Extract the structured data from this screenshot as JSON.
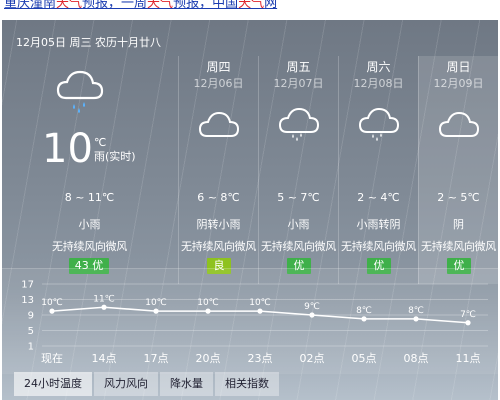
{
  "header": {
    "parts": [
      {
        "text": "重庆潼南",
        "accent": false
      },
      {
        "text": "天气",
        "accent": true
      },
      {
        "text": "预报，一周",
        "accent": false
      },
      {
        "text": "天气",
        "accent": true
      },
      {
        "text": "预报，中国",
        "accent": false
      },
      {
        "text": "天气",
        "accent": true
      },
      {
        "text": "网",
        "accent": false
      }
    ]
  },
  "today": {
    "date_line": "12月05日 周三 农历十月廿八",
    "temp": "10",
    "unit": "℃",
    "realtime": "雨(实时)",
    "range": "8 ~ 11℃",
    "cond": "小雨",
    "wind": "无持续风向微风",
    "aqi": "43  优",
    "icon": "cloud-rain-icon"
  },
  "days": [
    {
      "name": "周四",
      "date": "12月06日",
      "range": "6 ~ 8℃",
      "cond": "阴转小雨",
      "wind": "无持续风向微风",
      "aqi": "良",
      "icon": "cloud-icon"
    },
    {
      "name": "周五",
      "date": "12月07日",
      "range": "5 ~ 7℃",
      "cond": "小雨",
      "wind": "无持续风向微风",
      "aqi": "优",
      "icon": "cloud-rain-icon"
    },
    {
      "name": "周六",
      "date": "12月08日",
      "range": "2 ~ 4℃",
      "cond": "小雨转阴",
      "wind": "无持续风向微风",
      "aqi": "优",
      "icon": "cloud-rain-icon"
    },
    {
      "name": "周日",
      "date": "12月09日",
      "range": "2 ~ 5℃",
      "cond": "阴",
      "wind": "无持续风向微风",
      "aqi": "优",
      "icon": "cloud-icon"
    }
  ],
  "colors": {
    "aqi_good": "#3fb04a",
    "aqi_moderate": "#8ec21f",
    "header_accent": "#e0262e",
    "header_link": "#1a3cb0"
  },
  "tabs": [
    "24小时温度",
    "风力风向",
    "降水量",
    "相关指数"
  ],
  "chart_data": {
    "type": "line",
    "categories": [
      "现在",
      "14点",
      "17点",
      "20点",
      "23点",
      "02点",
      "05点",
      "08点",
      "11点"
    ],
    "series": [
      {
        "values": [
          10,
          11,
          10,
          10,
          10,
          9,
          8,
          8,
          7
        ]
      }
    ],
    "value_labels": [
      "10℃",
      "11℃",
      "10℃",
      "10℃",
      "10℃",
      "9℃",
      "8℃",
      "8℃",
      "7℃"
    ],
    "yticks": [
      1,
      5,
      9,
      13,
      17
    ],
    "ylim": [
      1,
      17
    ],
    "grid": true,
    "title": "",
    "xlabel": "",
    "ylabel": ""
  }
}
